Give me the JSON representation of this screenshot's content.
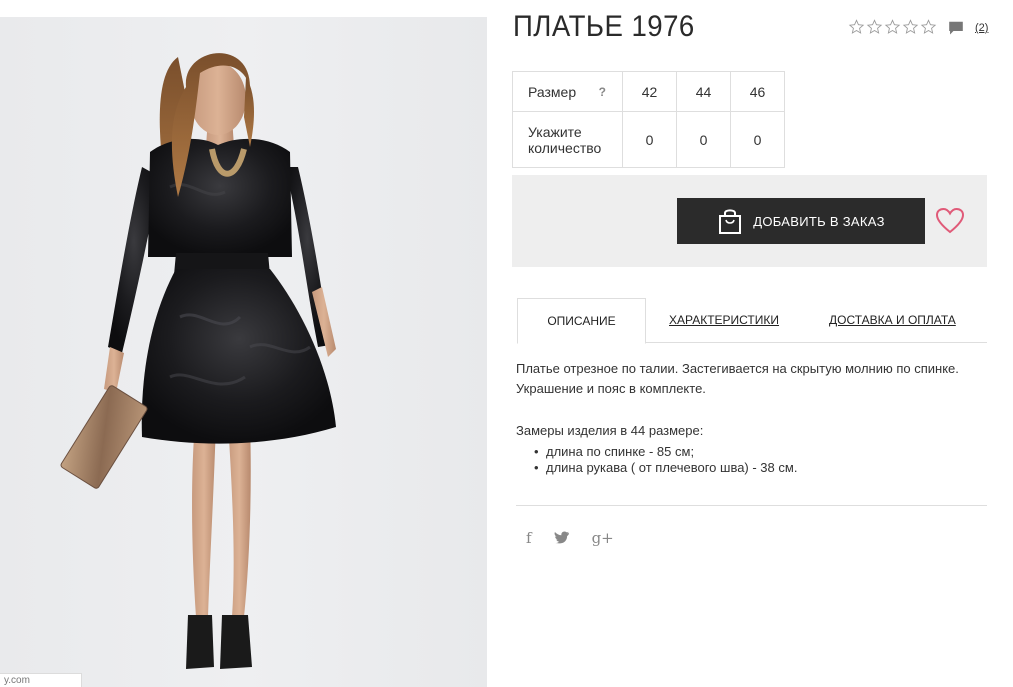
{
  "product": {
    "title": "ПЛАТЬЕ 1976",
    "rating_stars": 0,
    "rating_max": 5,
    "comments_count": "(2)"
  },
  "image": {
    "alt": "Model in black crushed-velvet dress holding a sequined clutch",
    "watermark": "y.com"
  },
  "sizes": {
    "size_label": "Размер",
    "help_label": "?",
    "values": [
      "42",
      "44",
      "46"
    ],
    "qty_label": "Укажите количество",
    "quantities": [
      "0",
      "0",
      "0"
    ]
  },
  "order": {
    "add_button_label": "ДОБАВИТЬ В ЗАКАЗ"
  },
  "tabs": [
    {
      "label": "ОПИСАНИЕ",
      "active": true
    },
    {
      "label": "ХАРАКТЕРИСТИКИ",
      "active": false
    },
    {
      "label": "ДОСТАВКА И ОПЛАТА",
      "active": false
    }
  ],
  "description": {
    "text": "Платье отрезное по талии. Застегивается на скрытую молнию по спинке. Украшение и пояс в комплекте.",
    "measures_title": "Замеры изделия в 44 размере:",
    "measures": [
      "длина по спинке - 85 см;",
      "длина рукава ( от плечевого шва) - 38 см."
    ]
  },
  "social": {
    "facebook": "f",
    "twitter": "twitter-icon",
    "googleplus": "g+"
  },
  "colors": {
    "button_bg": "#2b2b2b",
    "heart": "#e05a78",
    "order_box_bg": "#eeeeee"
  }
}
